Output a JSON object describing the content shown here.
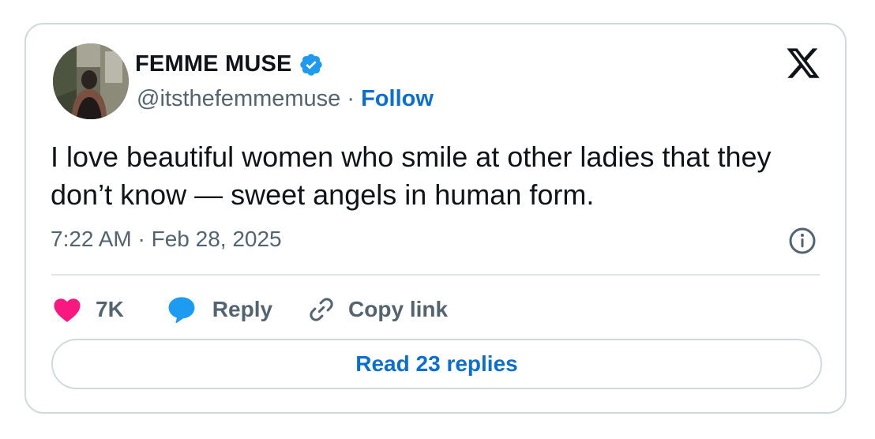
{
  "tweet": {
    "author": {
      "name": "FEMME MUSE",
      "handle": "@itsthefemmemuse",
      "separator": "·",
      "follow_label": "Follow",
      "verified": true
    },
    "text": "I love beautiful women who smile at other ladies that they don’t know — sweet angels in human form.",
    "timestamp": "7:22 AM · Feb 28, 2025",
    "actions": {
      "likes_count": "7K",
      "reply_label": "Reply",
      "copy_link_label": "Copy link"
    },
    "read_replies_label": "Read 23 replies"
  },
  "icons": [
    "x-logo-icon",
    "verified-badge-icon",
    "heart-icon",
    "reply-bubble-icon",
    "link-icon",
    "info-icon"
  ],
  "colors": {
    "text": "#0f1419",
    "secondary": "#536471",
    "link": "#0a6fd0",
    "verified": "#1d9bf0",
    "heart": "#f91880",
    "reply_bubble": "#1d9bf0",
    "border": "#cfd9de"
  }
}
